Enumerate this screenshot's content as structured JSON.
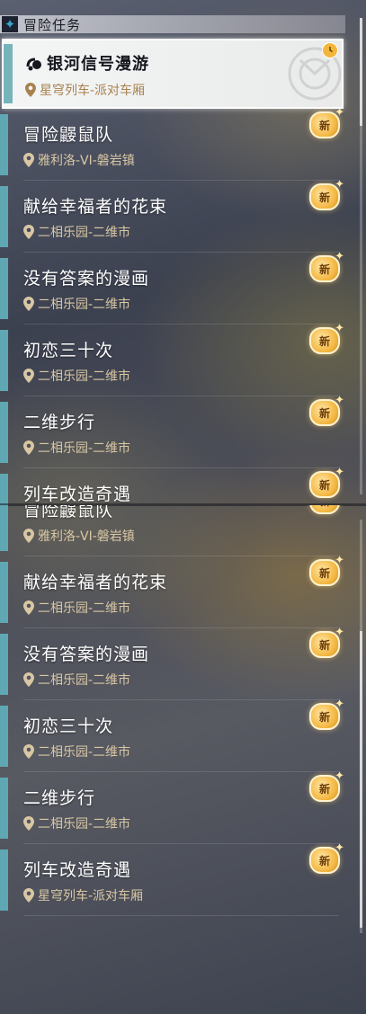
{
  "section": {
    "title": "冒险任务"
  },
  "top_list": {
    "selected": {
      "title": "银河信号漫游",
      "location": "星穹列车-派对车厢"
    },
    "items": [
      {
        "title": "冒险鼹鼠队",
        "location": "雅利洛-VI-磐岩镇",
        "badge": "新"
      },
      {
        "title": "献给幸福者的花束",
        "location": "二相乐园-二维市",
        "badge": "新"
      },
      {
        "title": "没有答案的漫画",
        "location": "二相乐园-二维市",
        "badge": "新"
      },
      {
        "title": "初恋三十次",
        "location": "二相乐园-二维市",
        "badge": "新"
      },
      {
        "title": "二维步行",
        "location": "二相乐园-二维市",
        "badge": "新"
      },
      {
        "title": "列车改造奇遇",
        "location": "",
        "badge": "新"
      }
    ]
  },
  "bottom_list": {
    "items": [
      {
        "title": "冒险鼹鼠队",
        "location": "雅利洛-VI-磐岩镇",
        "badge": "新"
      },
      {
        "title": "献给幸福者的花束",
        "location": "二相乐园-二维市",
        "badge": "新"
      },
      {
        "title": "没有答案的漫画",
        "location": "二相乐园-二维市",
        "badge": "新"
      },
      {
        "title": "初恋三十次",
        "location": "二相乐园-二维市",
        "badge": "新"
      },
      {
        "title": "二维步行",
        "location": "二相乐园-二维市",
        "badge": "新"
      },
      {
        "title": "列车改造奇遇",
        "location": "星穹列车-派对车厢",
        "badge": "新"
      }
    ]
  },
  "colors": {
    "accent": "#5fa8b3",
    "location_text": "#d9c7a4",
    "badge": "#f3b640"
  },
  "icons": {
    "section": "diamond-star-icon",
    "location": "location-pin-icon",
    "selected_tag": "signal-icon",
    "clock": "clock-icon"
  }
}
